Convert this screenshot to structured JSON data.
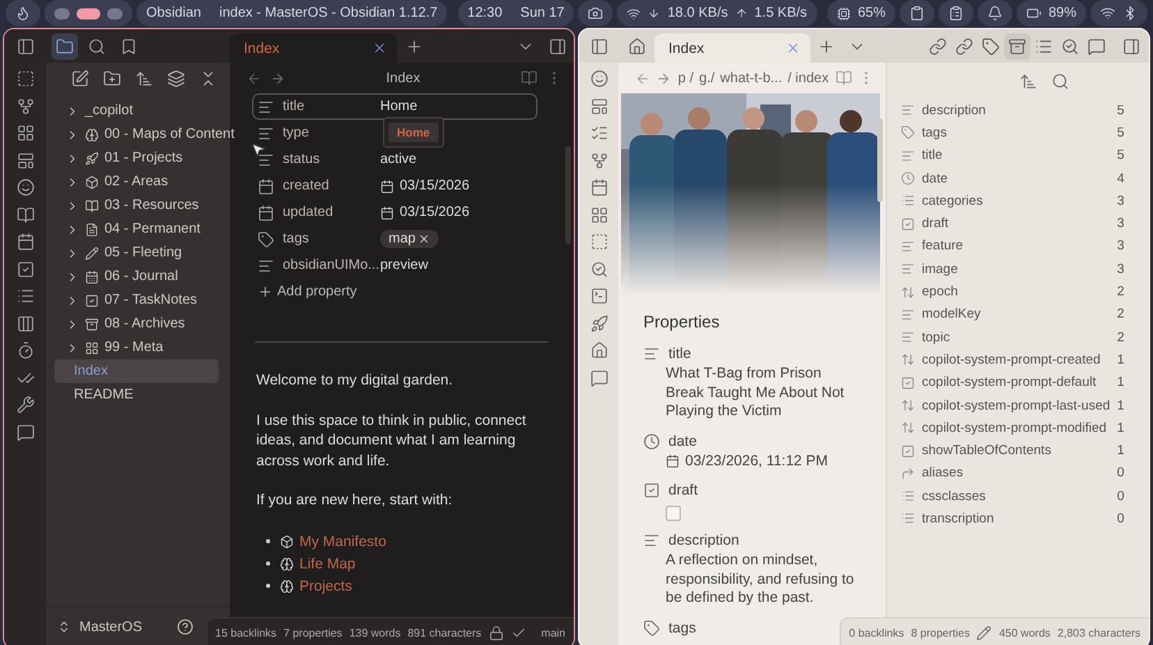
{
  "topbar": {
    "workspaces": [
      {
        "selected": false
      },
      {
        "selected": true
      },
      {
        "selected": false
      }
    ],
    "app": "Obsidian",
    "window_title": "index - MasterOS - Obsidian 1.12.7",
    "time": "12:30",
    "day": "Sun 17",
    "download": "18.0 KB/s",
    "upload": "1.5 KB/s",
    "cpu": "65%",
    "battery": "89%"
  },
  "left": {
    "tab": "Index",
    "note_title": "Index",
    "tree": [
      {
        "label": "_copilot"
      },
      {
        "label": "00 - Maps of Content"
      },
      {
        "label": "01 - Projects"
      },
      {
        "label": "02 - Areas"
      },
      {
        "label": "03 - Resources"
      },
      {
        "label": "04 - Permanent"
      },
      {
        "label": "05 - Fleeting"
      },
      {
        "label": "06 - Journal"
      },
      {
        "label": "07 - TaskNotes"
      },
      {
        "label": "08 - Archives"
      },
      {
        "label": "99 - Meta"
      }
    ],
    "files": [
      {
        "label": "Index",
        "selected": true
      },
      {
        "label": "README",
        "selected": false
      }
    ],
    "vault": "MasterOS",
    "properties": [
      {
        "kind": "text",
        "name": "title",
        "value": "Home",
        "focused": true
      },
      {
        "kind": "text",
        "name": "type",
        "focused": false
      },
      {
        "kind": "text",
        "name": "status",
        "value": "active",
        "focused": false
      },
      {
        "kind": "date",
        "name": "created",
        "value": "03/15/2026",
        "focused": false
      },
      {
        "kind": "date",
        "name": "updated",
        "value": "03/15/2026",
        "focused": false
      },
      {
        "kind": "tags",
        "name": "tags",
        "tags": [
          "map"
        ],
        "focused": false
      },
      {
        "kind": "text",
        "name": "obsidianUIMo...",
        "value": "preview",
        "focused": false
      }
    ],
    "suggestion": "Home",
    "add_property": "Add property",
    "paragraphs": [
      "Welcome to my digital garden.",
      "I use this space to think in public, connect ideas, and document what I am learning across work and life.",
      "If you are new here, start with:"
    ],
    "links": [
      "My Manifesto",
      "Life Map",
      "Projects"
    ],
    "status": [
      "15 backlinks",
      "7 properties",
      "139 words",
      "891 characters"
    ],
    "branch": "main"
  },
  "right": {
    "tab": "Index",
    "breadcrumb": [
      "p /",
      "g./",
      "what-t-b...",
      "/ index"
    ],
    "picture": {
      "kind": "picture"
    },
    "properties_heading": "Properties",
    "properties": [
      {
        "kind": "text",
        "name": "title",
        "value": "What T-Bag from Prison Break Taught Me About Not Playing the Victim"
      },
      {
        "kind": "datetime",
        "name": "date",
        "value": "03/23/2026, 11:12 PM"
      },
      {
        "kind": "checkbox",
        "name": "draft",
        "checked": false
      },
      {
        "kind": "text",
        "name": "description",
        "value": "A reflection on mindset, responsibility, and refusing to be defined by the past."
      },
      {
        "kind": "tags",
        "name": "tags"
      }
    ],
    "all_properties": [
      {
        "kind": "text",
        "name": "description",
        "count": "5"
      },
      {
        "kind": "tags",
        "name": "tags",
        "count": "5"
      },
      {
        "kind": "text",
        "name": "title",
        "count": "5"
      },
      {
        "kind": "datetime",
        "name": "date",
        "count": "4"
      },
      {
        "kind": "list",
        "name": "categories",
        "count": "3"
      },
      {
        "kind": "checkbox",
        "name": "draft",
        "count": "3"
      },
      {
        "kind": "text",
        "name": "feature",
        "count": "3"
      },
      {
        "kind": "text",
        "name": "image",
        "count": "3"
      },
      {
        "kind": "number",
        "name": "epoch",
        "count": "2"
      },
      {
        "kind": "text",
        "name": "modelKey",
        "count": "2"
      },
      {
        "kind": "text",
        "name": "topic",
        "count": "2"
      },
      {
        "kind": "number",
        "name": "copilot-system-prompt-created",
        "count": "1"
      },
      {
        "kind": "checkbox",
        "name": "copilot-system-prompt-default",
        "count": "1"
      },
      {
        "kind": "number",
        "name": "copilot-system-prompt-last-used",
        "count": "1"
      },
      {
        "kind": "number",
        "name": "copilot-system-prompt-modified",
        "count": "1"
      },
      {
        "kind": "checkbox",
        "name": "showTableOfContents",
        "count": "1"
      },
      {
        "kind": "aliases",
        "name": "aliases",
        "count": "0"
      },
      {
        "kind": "list",
        "name": "cssclasses",
        "count": "0"
      },
      {
        "kind": "list",
        "name": "transcription",
        "count": "0"
      }
    ],
    "status": [
      "0 backlinks",
      "8 properties",
      "450 words",
      "2,803 characters"
    ]
  }
}
